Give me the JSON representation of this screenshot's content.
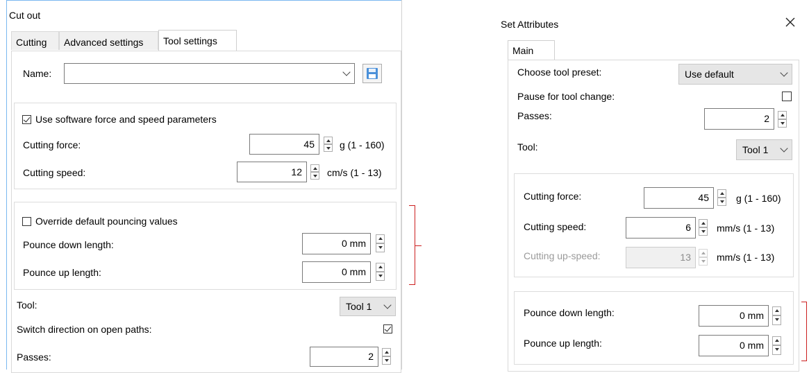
{
  "left_dialog": {
    "title": "Cut out",
    "tabs": [
      {
        "label": "Cutting"
      },
      {
        "label": "Advanced settings"
      },
      {
        "label": "Tool settings",
        "active": true
      }
    ],
    "name_label": "Name:",
    "name_value": "",
    "save_icon": "floppy-disk-icon",
    "software_params": {
      "checkbox_label": "Use software force and speed parameters",
      "checked": true,
      "cutting_force_label": "Cutting force:",
      "cutting_force_value": "45",
      "cutting_force_unit": "g (1 - 160)",
      "cutting_speed_label": "Cutting speed:",
      "cutting_speed_value": "12",
      "cutting_speed_unit": "cm/s (1 - 13)"
    },
    "pouncing": {
      "checkbox_label": "Override default pouncing values",
      "checked": false,
      "down_label": "Pounce down length:",
      "down_value": "0 mm",
      "up_label": "Pounce up length:",
      "up_value": "0 mm"
    },
    "tool_label": "Tool:",
    "tool_value": "Tool 1",
    "switch_label": "Switch direction on open paths:",
    "switch_checked": true,
    "passes_label": "Passes:",
    "passes_value": "2"
  },
  "right_dialog": {
    "title": "Set Attributes",
    "close_icon": "close-icon",
    "tabs": [
      {
        "label": "Main",
        "active": true
      }
    ],
    "preset_label": "Choose tool preset:",
    "preset_value": "Use default",
    "pause_label": "Pause for tool change:",
    "pause_checked": false,
    "passes_label": "Passes:",
    "passes_value": "2",
    "tool_label": "Tool:",
    "tool_value": "Tool 1",
    "cutting": {
      "force_label": "Cutting force:",
      "force_value": "45",
      "force_unit": "g (1 - 160)",
      "speed_label": "Cutting speed:",
      "speed_value": "6",
      "speed_unit": "mm/s (1 - 13)",
      "upspeed_label": "Cutting up-speed:",
      "upspeed_value": "13",
      "upspeed_unit": "mm/s (1 - 13)"
    },
    "pouncing": {
      "down_label": "Pounce down length:",
      "down_value": "0 mm",
      "up_label": "Pounce up length:",
      "up_value": "0 mm"
    }
  },
  "colors": {
    "annotation_bracket": "#cc1f1f",
    "frame_border": "#1e90ff"
  }
}
